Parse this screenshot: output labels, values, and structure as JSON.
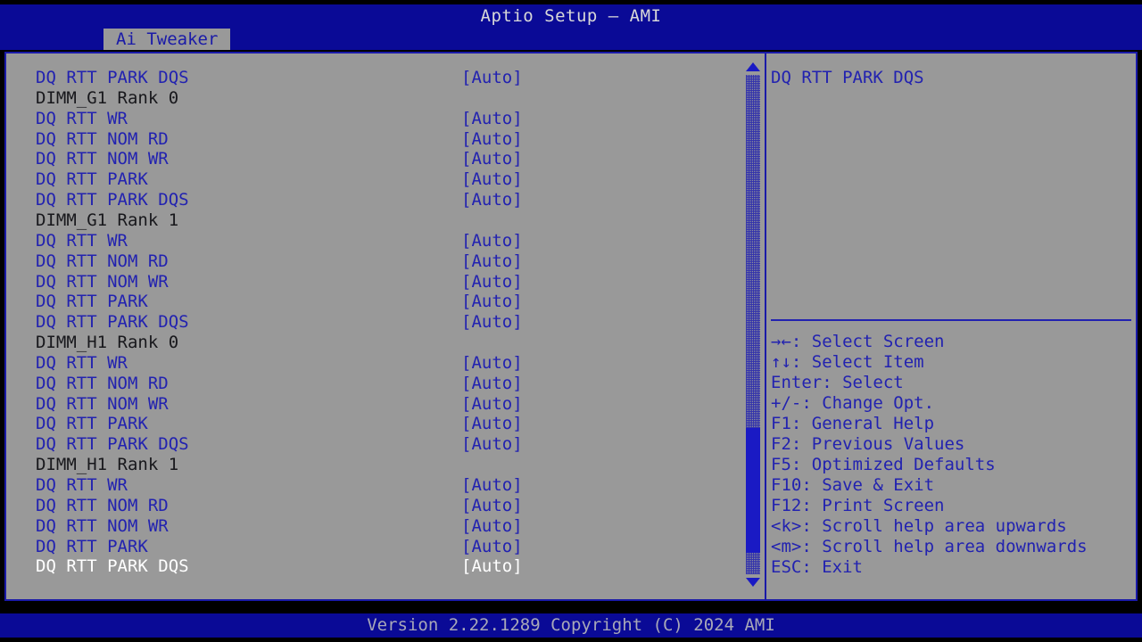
{
  "header": {
    "title": "Aptio Setup – AMI"
  },
  "tabs": [
    {
      "label": "Ai Tweaker",
      "active": true
    }
  ],
  "menu": {
    "rows": [
      {
        "label": "DQ RTT PARK DQS",
        "value": "[Auto]",
        "kind": "option",
        "selected": false
      },
      {
        "label": "DIMM_G1 Rank 0",
        "value": "",
        "kind": "header",
        "selected": false
      },
      {
        "label": "DQ RTT WR",
        "value": "[Auto]",
        "kind": "option",
        "selected": false
      },
      {
        "label": "DQ RTT NOM RD",
        "value": "[Auto]",
        "kind": "option",
        "selected": false
      },
      {
        "label": "DQ RTT NOM WR",
        "value": "[Auto]",
        "kind": "option",
        "selected": false
      },
      {
        "label": "DQ RTT PARK",
        "value": "[Auto]",
        "kind": "option",
        "selected": false
      },
      {
        "label": "DQ RTT PARK DQS",
        "value": "[Auto]",
        "kind": "option",
        "selected": false
      },
      {
        "label": "DIMM_G1 Rank 1",
        "value": "",
        "kind": "header",
        "selected": false
      },
      {
        "label": "DQ RTT WR",
        "value": "[Auto]",
        "kind": "option",
        "selected": false
      },
      {
        "label": "DQ RTT NOM RD",
        "value": "[Auto]",
        "kind": "option",
        "selected": false
      },
      {
        "label": "DQ RTT NOM WR",
        "value": "[Auto]",
        "kind": "option",
        "selected": false
      },
      {
        "label": "DQ RTT PARK",
        "value": "[Auto]",
        "kind": "option",
        "selected": false
      },
      {
        "label": "DQ RTT PARK DQS",
        "value": "[Auto]",
        "kind": "option",
        "selected": false
      },
      {
        "label": "DIMM_H1 Rank 0",
        "value": "",
        "kind": "header",
        "selected": false
      },
      {
        "label": "DQ RTT WR",
        "value": "[Auto]",
        "kind": "option",
        "selected": false
      },
      {
        "label": "DQ RTT NOM RD",
        "value": "[Auto]",
        "kind": "option",
        "selected": false
      },
      {
        "label": "DQ RTT NOM WR",
        "value": "[Auto]",
        "kind": "option",
        "selected": false
      },
      {
        "label": "DQ RTT PARK",
        "value": "[Auto]",
        "kind": "option",
        "selected": false
      },
      {
        "label": "DQ RTT PARK DQS",
        "value": "[Auto]",
        "kind": "option",
        "selected": false
      },
      {
        "label": "DIMM_H1 Rank 1",
        "value": "",
        "kind": "header",
        "selected": false
      },
      {
        "label": "DQ RTT WR",
        "value": "[Auto]",
        "kind": "option",
        "selected": false
      },
      {
        "label": "DQ RTT NOM RD",
        "value": "[Auto]",
        "kind": "option",
        "selected": false
      },
      {
        "label": "DQ RTT NOM WR",
        "value": "[Auto]",
        "kind": "option",
        "selected": false
      },
      {
        "label": "DQ RTT PARK",
        "value": "[Auto]",
        "kind": "option",
        "selected": false
      },
      {
        "label": "DQ RTT PARK DQS",
        "value": "[Auto]",
        "kind": "option",
        "selected": true
      }
    ]
  },
  "scrollbar": {
    "up_arrow": "scroll-up-arrow",
    "down_arrow": "scroll-down-arrow"
  },
  "help": {
    "title": "DQ RTT PARK DQS",
    "body": ""
  },
  "legend": [
    {
      "keys": "→←",
      "desc": ": Select Screen"
    },
    {
      "keys": "↑↓",
      "desc": ": Select Item"
    },
    {
      "keys": "Enter",
      "desc": ": Select"
    },
    {
      "keys": "+/-",
      "desc": ": Change Opt."
    },
    {
      "keys": "F1",
      "desc": ": General Help"
    },
    {
      "keys": "F2",
      "desc": ": Previous Values"
    },
    {
      "keys": "F5",
      "desc": ": Optimized Defaults"
    },
    {
      "keys": "F10",
      "desc": ": Save & Exit"
    },
    {
      "keys": "F12",
      "desc": ": Print Screen"
    },
    {
      "keys": "<k>",
      "desc": ": Scroll help area upwards"
    },
    {
      "keys": "<m>",
      "desc": ": Scroll help area downwards"
    },
    {
      "keys": "ESC",
      "desc": ": Exit"
    }
  ],
  "footer": {
    "text": "Version 2.22.1289 Copyright (C) 2024 AMI"
  },
  "colors": {
    "background": "#999999",
    "bar_blue": "#0A0A96",
    "border_blue": "#1A1AA8",
    "option_text": "#2222B0",
    "header_text": "#18181C",
    "selected_text": "#FFFFFF",
    "title_text": "#D8D8D8",
    "footer_text": "#A8A8B8"
  }
}
